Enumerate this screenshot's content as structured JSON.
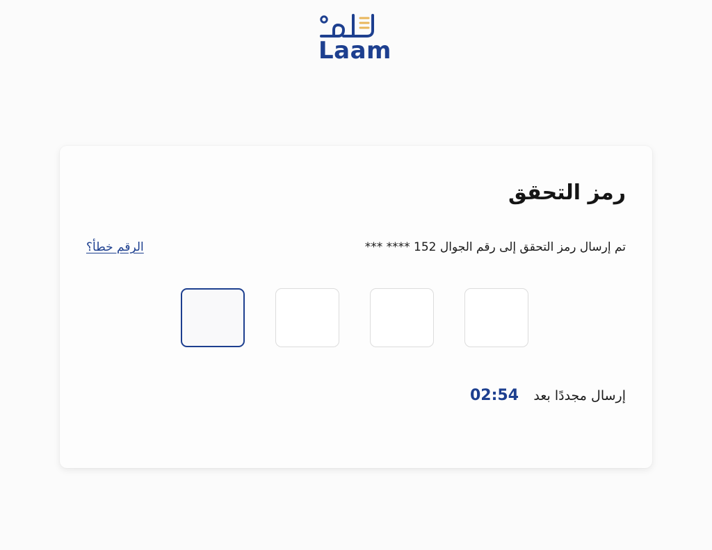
{
  "logo": {
    "latin_text": "Laam",
    "colors": {
      "primary": "#1d3f8f",
      "accent": "#e8b65a"
    }
  },
  "verification": {
    "title": "رمز التحقق",
    "description": "تم إرسال رمز التحقق إلى رقم الجوال 152 **** ***",
    "wrong_number_link": "الرقم خطأ؟",
    "otp_digits": [
      "",
      "",
      "",
      ""
    ],
    "resend_label": "إرسال مجددًا بعد",
    "timer": "02:54"
  }
}
